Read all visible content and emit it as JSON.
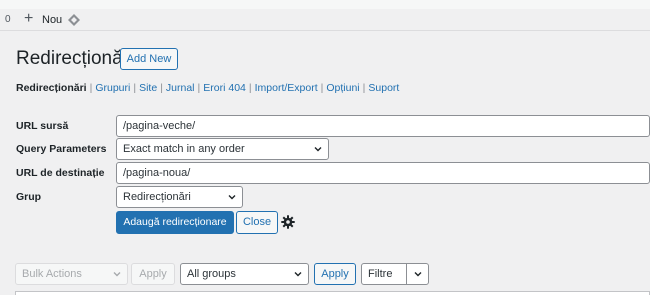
{
  "adminbar": {
    "count": "0",
    "new_label": "Nou"
  },
  "page": {
    "title": "Redirecționări",
    "add_new_label": "Add New"
  },
  "subnav": {
    "items": [
      {
        "label": "Redirecționări",
        "current": true
      },
      {
        "label": "Grupuri"
      },
      {
        "label": "Site"
      },
      {
        "label": "Jurnal"
      },
      {
        "label": "Erori 404"
      },
      {
        "label": "Import/Export"
      },
      {
        "label": "Opțiuni"
      },
      {
        "label": "Suport"
      }
    ],
    "separator": "|"
  },
  "form": {
    "source_label": "URL sursă",
    "source_value": "/pagina-veche/",
    "query_label": "Query Parameters",
    "query_value": "Exact match in any order",
    "target_label": "URL de destinație",
    "target_value": "/pagina-noua/",
    "group_label": "Grup",
    "group_value": "Redirecționări",
    "submit_label": "Adaugă redirecționare",
    "close_label": "Close"
  },
  "table_nav": {
    "bulk_actions": "Bulk Actions",
    "apply_label": "Apply",
    "groups_value": "All groups",
    "apply2_label": "Apply",
    "filter_label": "Filtre"
  },
  "colors": {
    "accent": "#2271b1",
    "background": "#f0f0f1"
  },
  "icons": [
    "plus-icon",
    "diamond-icon",
    "chevron-down-icon",
    "gear-icon"
  ]
}
